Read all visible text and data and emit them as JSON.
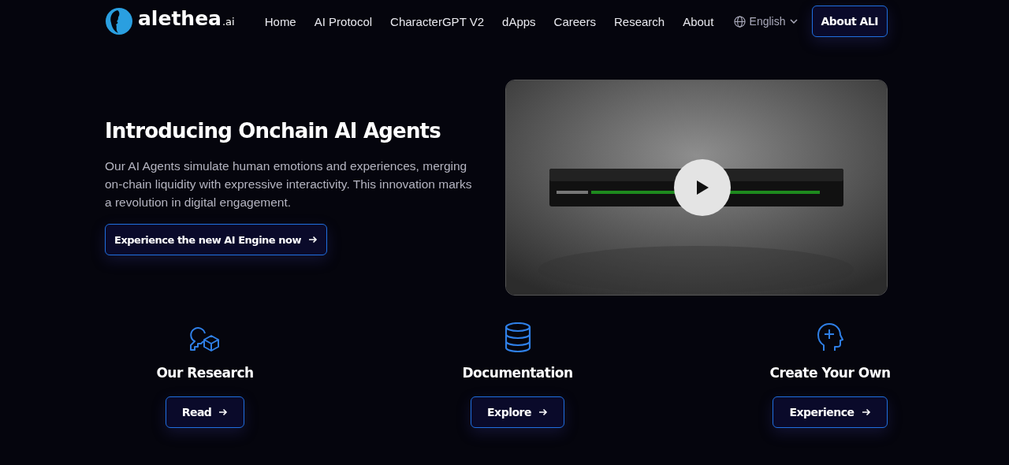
{
  "header": {
    "logo": {
      "name": "alethea",
      "suffix": ".ai"
    },
    "nav": [
      {
        "label": "Home"
      },
      {
        "label": "AI Protocol"
      },
      {
        "label": "CharacterGPT V2"
      },
      {
        "label": "dApps"
      },
      {
        "label": "Careers"
      },
      {
        "label": "Research"
      },
      {
        "label": "About"
      }
    ],
    "language": "English",
    "cta": "About ALI"
  },
  "hero": {
    "title": "Introducing Onchain AI Agents",
    "text": "Our AI Agents simulate human emotions and experiences, merging on-chain liquidity with expressive interactivity. This innovation marks a revolution in digital engagement.",
    "button": "Experience the new AI Engine now"
  },
  "features": [
    {
      "kind": "research",
      "title": "Our Research",
      "button": "Read"
    },
    {
      "kind": "database",
      "title": "Documentation",
      "button": "Explore"
    },
    {
      "kind": "head",
      "title": "Create Your Own",
      "button": "Experience"
    }
  ]
}
